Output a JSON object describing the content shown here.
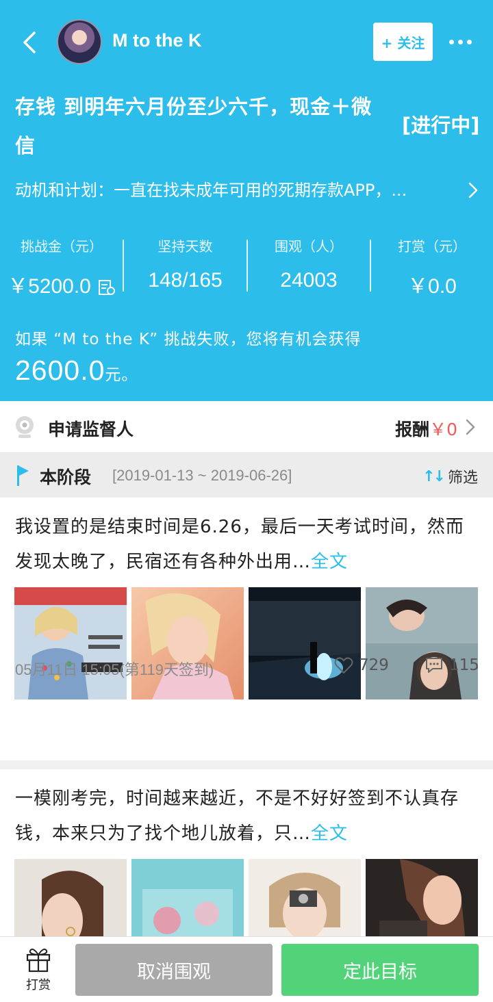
{
  "header": {
    "user_name": "M to the K",
    "follow_label": "+ 关注",
    "goal_title": "存钱 到明年六月份至少六千，现金＋微信",
    "status": "[进行中]",
    "motivation": "动机和计划：一直在找未成年可用的死期存款APP，..."
  },
  "stats": [
    {
      "label": "挑战金（元）",
      "value": "￥5200.0"
    },
    {
      "label": "坚持天数",
      "value": "148/165"
    },
    {
      "label": "围观（人）",
      "value": "24003"
    },
    {
      "label": "打赏（元）",
      "value": "￥0.0"
    }
  ],
  "reward": {
    "line": "如果 “M to the K” 挑战失败，您将有机会获得",
    "amount": "2600.0",
    "unit": "元。"
  },
  "supervisor": {
    "label": "申请监督人",
    "reward_label": "报酬",
    "reward_value": "￥0"
  },
  "stage": {
    "title": "本阶段",
    "range": "[2019-01-13 ~ 2019-06-26]",
    "filter_label": "筛选"
  },
  "posts": [
    {
      "text": "我设置的是结束时间是6.26，最后一天考试时间，然而发现太晚了，民宿还有各种外出用…",
      "more": "全文",
      "date": "05月11日 15:05(第119天签到)",
      "likes": "729",
      "comments": "115"
    },
    {
      "text": "一模刚考完，时间越来越近，不是不好好签到不认真存钱，本来只为了找个地儿放着，只…",
      "more": "全文"
    }
  ],
  "bottom": {
    "gift_label": "打赏",
    "cancel_label": "取消围观",
    "set_label": "定此目标"
  },
  "colors": {
    "accent": "#2cbdeb",
    "green": "#52d37a",
    "red": "#f25a5a",
    "gray_button": "#a9a9a9"
  }
}
